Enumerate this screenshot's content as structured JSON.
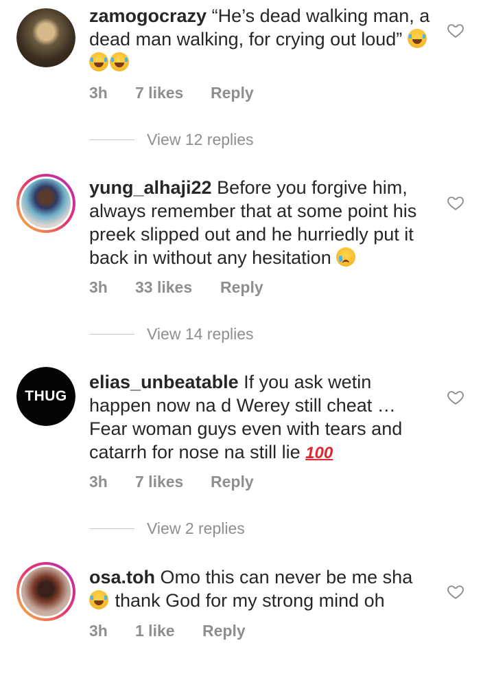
{
  "comments": [
    {
      "username": "zamogocrazy",
      "text": "“He’s dead walking man, a dead man walking, for crying out loud”",
      "emoji": "😂😂😂",
      "time": "3h",
      "likes": "7 likes",
      "reply_label": "Reply",
      "view_replies": "View 12 replies",
      "avatar_icon": "avatar-photo"
    },
    {
      "username": "yung_alhaji22",
      "text": "Before you forgive him, always remember that at some point his preek slipped out and he hurriedly put it back in without any hesitation",
      "emoji": "😢",
      "time": "3h",
      "likes": "33 likes",
      "reply_label": "Reply",
      "view_replies": "View 14 replies",
      "avatar_icon": "avatar-photo-story"
    },
    {
      "username": "elias_unbeatable",
      "text": "If you ask wetin happen now na d Werey still cheat … Fear woman guys even with tears and catarrh for nose na still lie",
      "emoji": "💯",
      "time": "3h",
      "likes": "7 likes",
      "reply_label": "Reply",
      "view_replies": "View 2 replies",
      "avatar_text": "THUG"
    },
    {
      "username": "osa.toh",
      "text": "Omo this can never be me sha",
      "text_after_emoji": "thank God for my strong mind oh",
      "emoji": "😂",
      "time": "3h",
      "likes": "1 like",
      "reply_label": "Reply",
      "avatar_icon": "avatar-photo-story"
    }
  ],
  "colors": {
    "text": "#262626",
    "secondary": "#8e8e8e",
    "divider": "#c7c7c7"
  },
  "icons": {
    "like": "heart-outline-icon"
  }
}
